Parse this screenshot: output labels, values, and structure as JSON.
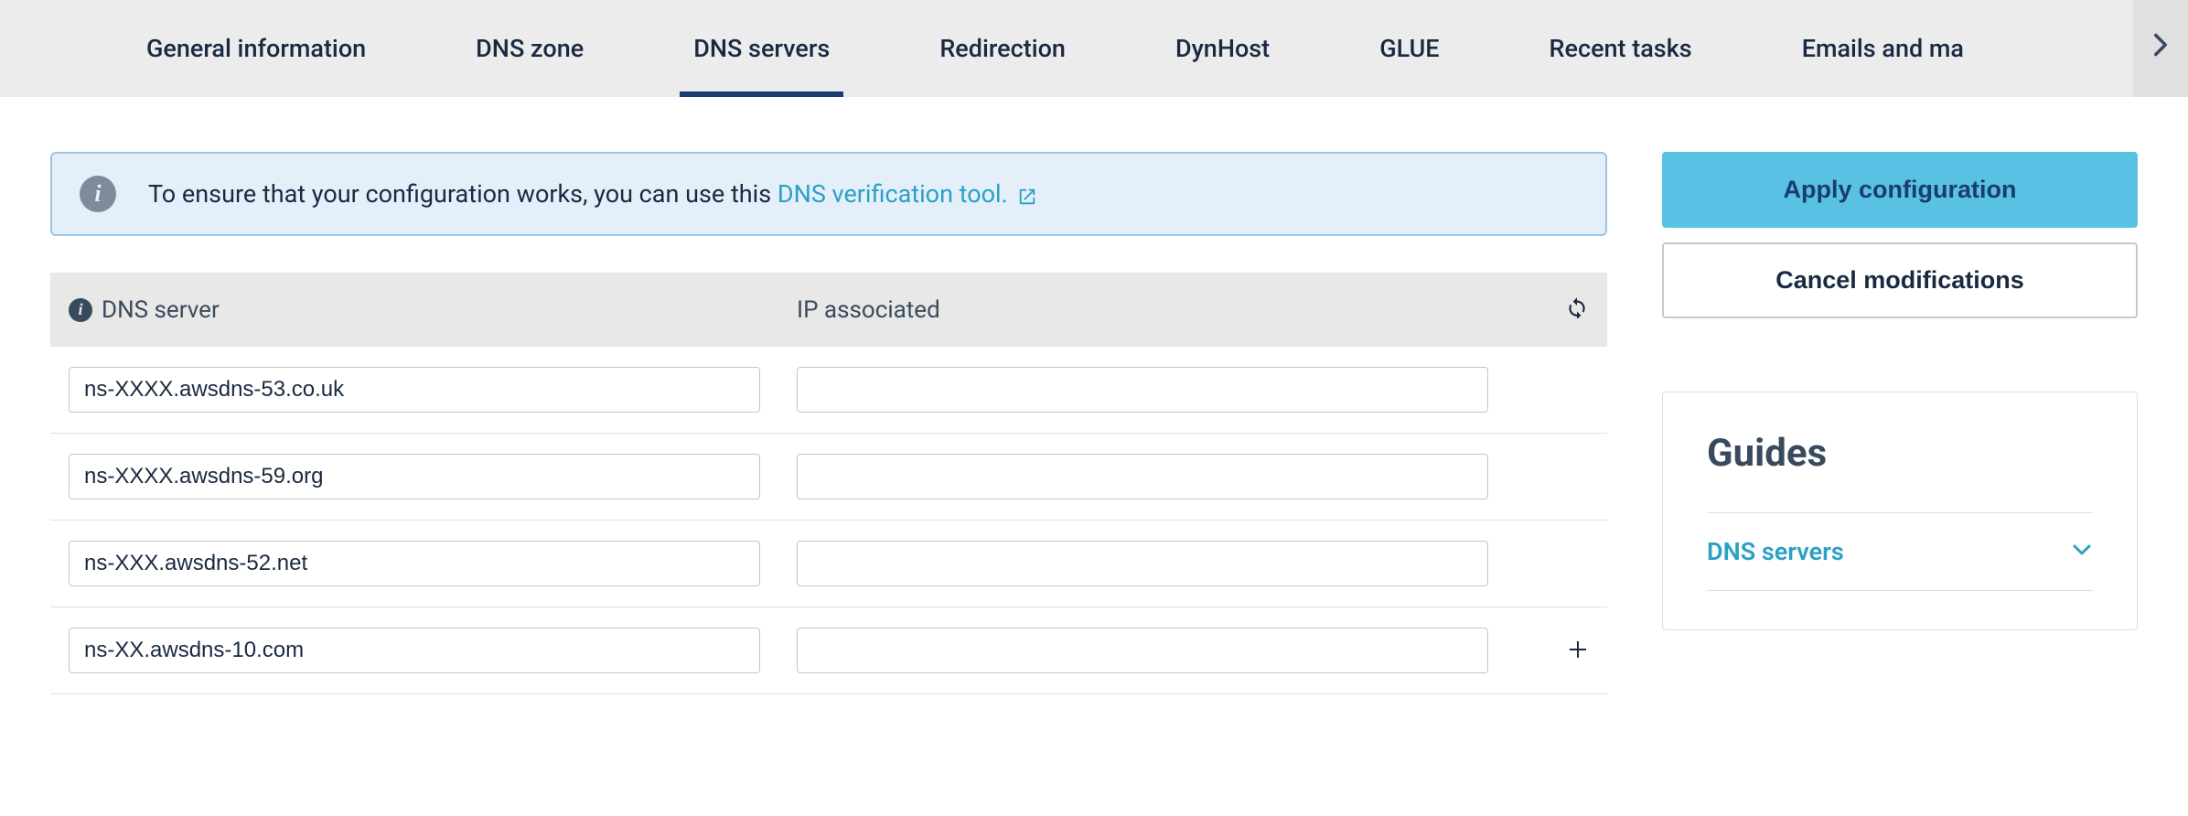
{
  "tabs": {
    "items": [
      {
        "label": "General information",
        "active": false
      },
      {
        "label": "DNS zone",
        "active": false
      },
      {
        "label": "DNS servers",
        "active": true
      },
      {
        "label": "Redirection",
        "active": false
      },
      {
        "label": "DynHost",
        "active": false
      },
      {
        "label": "GLUE",
        "active": false
      },
      {
        "label": "Recent tasks",
        "active": false
      },
      {
        "label": "Emails and ma",
        "active": false
      }
    ]
  },
  "alert": {
    "text_prefix": "To ensure that your configuration works, you can use this ",
    "link_text": "DNS verification tool."
  },
  "table": {
    "header_dns": "DNS server",
    "header_ip": "IP associated",
    "rows": [
      {
        "dns": "ns-XXXX.awsdns-53.co.uk",
        "ip": ""
      },
      {
        "dns": "ns-XXXX.awsdns-59.org",
        "ip": ""
      },
      {
        "dns": "ns-XXX.awsdns-52.net",
        "ip": ""
      },
      {
        "dns": "ns-XX.awsdns-10.com",
        "ip": ""
      }
    ]
  },
  "sidebar": {
    "apply_label": "Apply configuration",
    "cancel_label": "Cancel modifications",
    "guides_title": "Guides",
    "guides_item": "DNS servers"
  }
}
